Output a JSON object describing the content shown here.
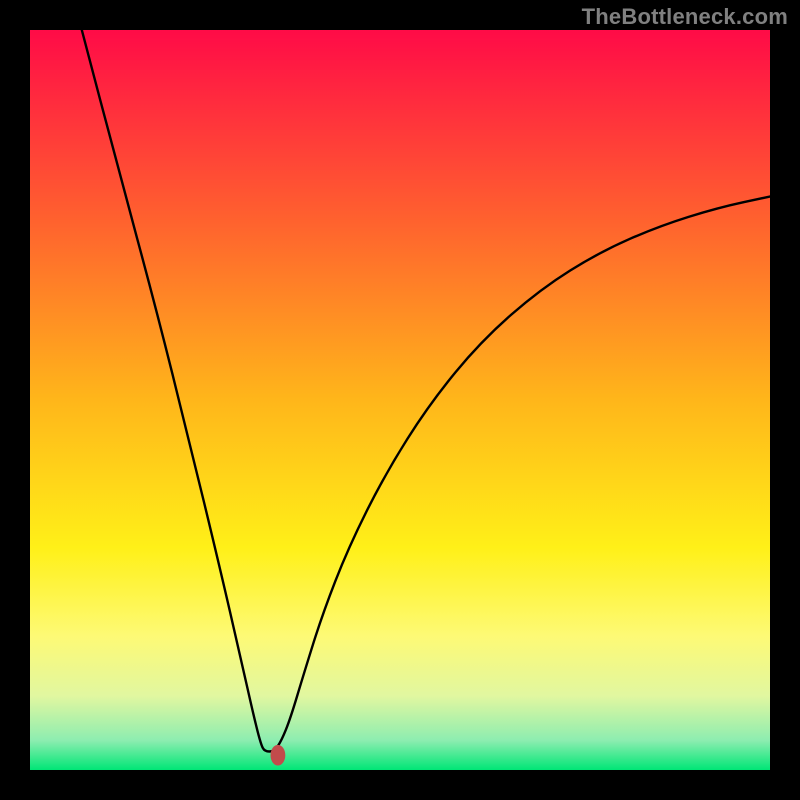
{
  "watermark": "TheBottleneck.com",
  "chart_data": {
    "type": "line",
    "title": "",
    "xlabel": "",
    "ylabel": "",
    "xlim": [
      0,
      1
    ],
    "ylim": [
      0,
      1
    ],
    "background_gradient": {
      "type": "vertical",
      "stops": [
        {
          "t": 0.0,
          "color": "#ff0b47"
        },
        {
          "t": 0.25,
          "color": "#ff5f2f"
        },
        {
          "t": 0.5,
          "color": "#ffb61a"
        },
        {
          "t": 0.7,
          "color": "#fff018"
        },
        {
          "t": 0.82,
          "color": "#fdfa76"
        },
        {
          "t": 0.9,
          "color": "#e1f7a0"
        },
        {
          "t": 0.96,
          "color": "#8dedb0"
        },
        {
          "t": 1.0,
          "color": "#00e676"
        }
      ]
    },
    "curve_note": "Black curve is a visual V-shape (no numeric axes) with minimum near x≈0.32; left branch starts at y≈1 at x≈0.07, right branch rises toward y≈0.75 at x=1. Values below are estimated screen-space samples (x,y in 0–1, y=1 at top).",
    "series": [
      {
        "name": "curve",
        "color": "#000000",
        "points": [
          {
            "x": 0.07,
            "y": 0.0
          },
          {
            "x": 0.12,
            "y": 0.19
          },
          {
            "x": 0.17,
            "y": 0.375
          },
          {
            "x": 0.215,
            "y": 0.555
          },
          {
            "x": 0.255,
            "y": 0.72
          },
          {
            "x": 0.285,
            "y": 0.85
          },
          {
            "x": 0.303,
            "y": 0.93
          },
          {
            "x": 0.312,
            "y": 0.965
          },
          {
            "x": 0.317,
            "y": 0.975
          },
          {
            "x": 0.33,
            "y": 0.975
          },
          {
            "x": 0.34,
            "y": 0.96
          },
          {
            "x": 0.352,
            "y": 0.93
          },
          {
            "x": 0.37,
            "y": 0.87
          },
          {
            "x": 0.395,
            "y": 0.79
          },
          {
            "x": 0.43,
            "y": 0.7
          },
          {
            "x": 0.48,
            "y": 0.6
          },
          {
            "x": 0.54,
            "y": 0.505
          },
          {
            "x": 0.61,
            "y": 0.42
          },
          {
            "x": 0.69,
            "y": 0.35
          },
          {
            "x": 0.77,
            "y": 0.3
          },
          {
            "x": 0.85,
            "y": 0.265
          },
          {
            "x": 0.93,
            "y": 0.24
          },
          {
            "x": 1.0,
            "y": 0.225
          }
        ]
      }
    ],
    "marker": {
      "x": 0.335,
      "y": 0.98,
      "rx": 0.01,
      "ry": 0.014,
      "color": "#c14b4b"
    }
  }
}
